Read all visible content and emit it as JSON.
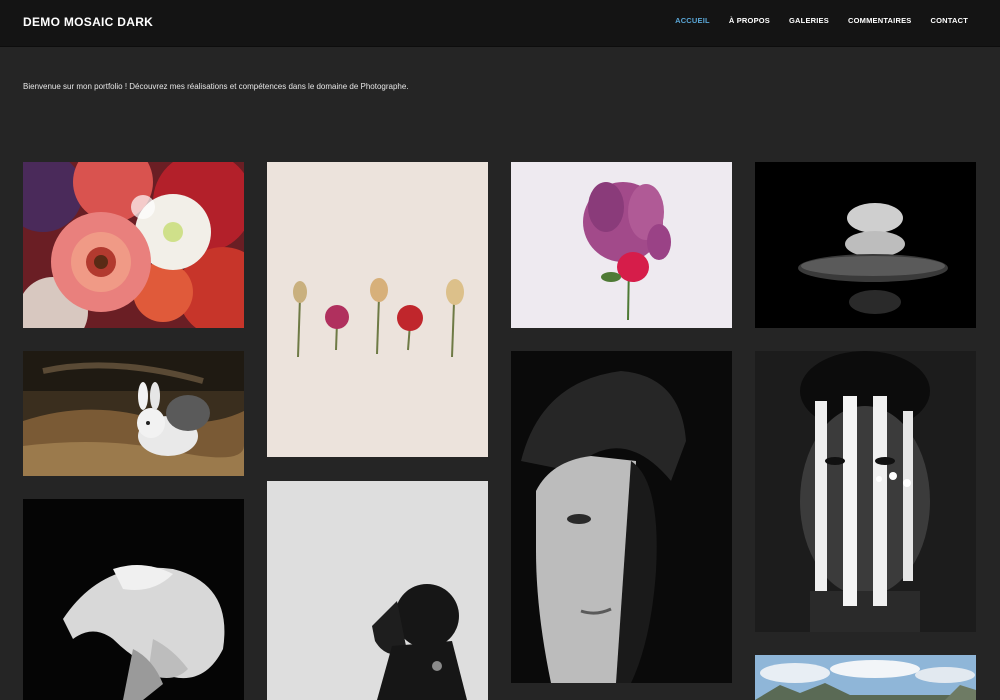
{
  "site": {
    "brand": "DEMO MOSAIC DARK",
    "nav": [
      {
        "label": "ACCUEIL",
        "active": true
      },
      {
        "label": "À PROPOS",
        "active": false
      },
      {
        "label": "GALERIES",
        "active": false
      },
      {
        "label": "COMMENTAIRES",
        "active": false
      },
      {
        "label": "CONTACT",
        "active": false
      }
    ]
  },
  "intro": {
    "text": "Bienvenue sur mon portfolio ! Découvrez mes réalisations et compétences dans le domaine de Photographe."
  },
  "colors": {
    "background": "#252525",
    "header": "#141414",
    "accent": "#5aa6d6"
  },
  "gallery": [
    {
      "subject": "flower-bouquet-photo"
    },
    {
      "subject": "rabbit-photo"
    },
    {
      "subject": "bw-portrait-hand-photo"
    },
    {
      "subject": "dried-flowers-photo"
    },
    {
      "subject": "bw-silhouette-photo"
    },
    {
      "subject": "lilac-rose-photo"
    },
    {
      "subject": "bw-portrait-shadow-photo"
    },
    {
      "subject": "stacked-stones-photo"
    },
    {
      "subject": "face-paint-portrait-photo"
    },
    {
      "subject": "mountain-clouds-photo"
    }
  ]
}
